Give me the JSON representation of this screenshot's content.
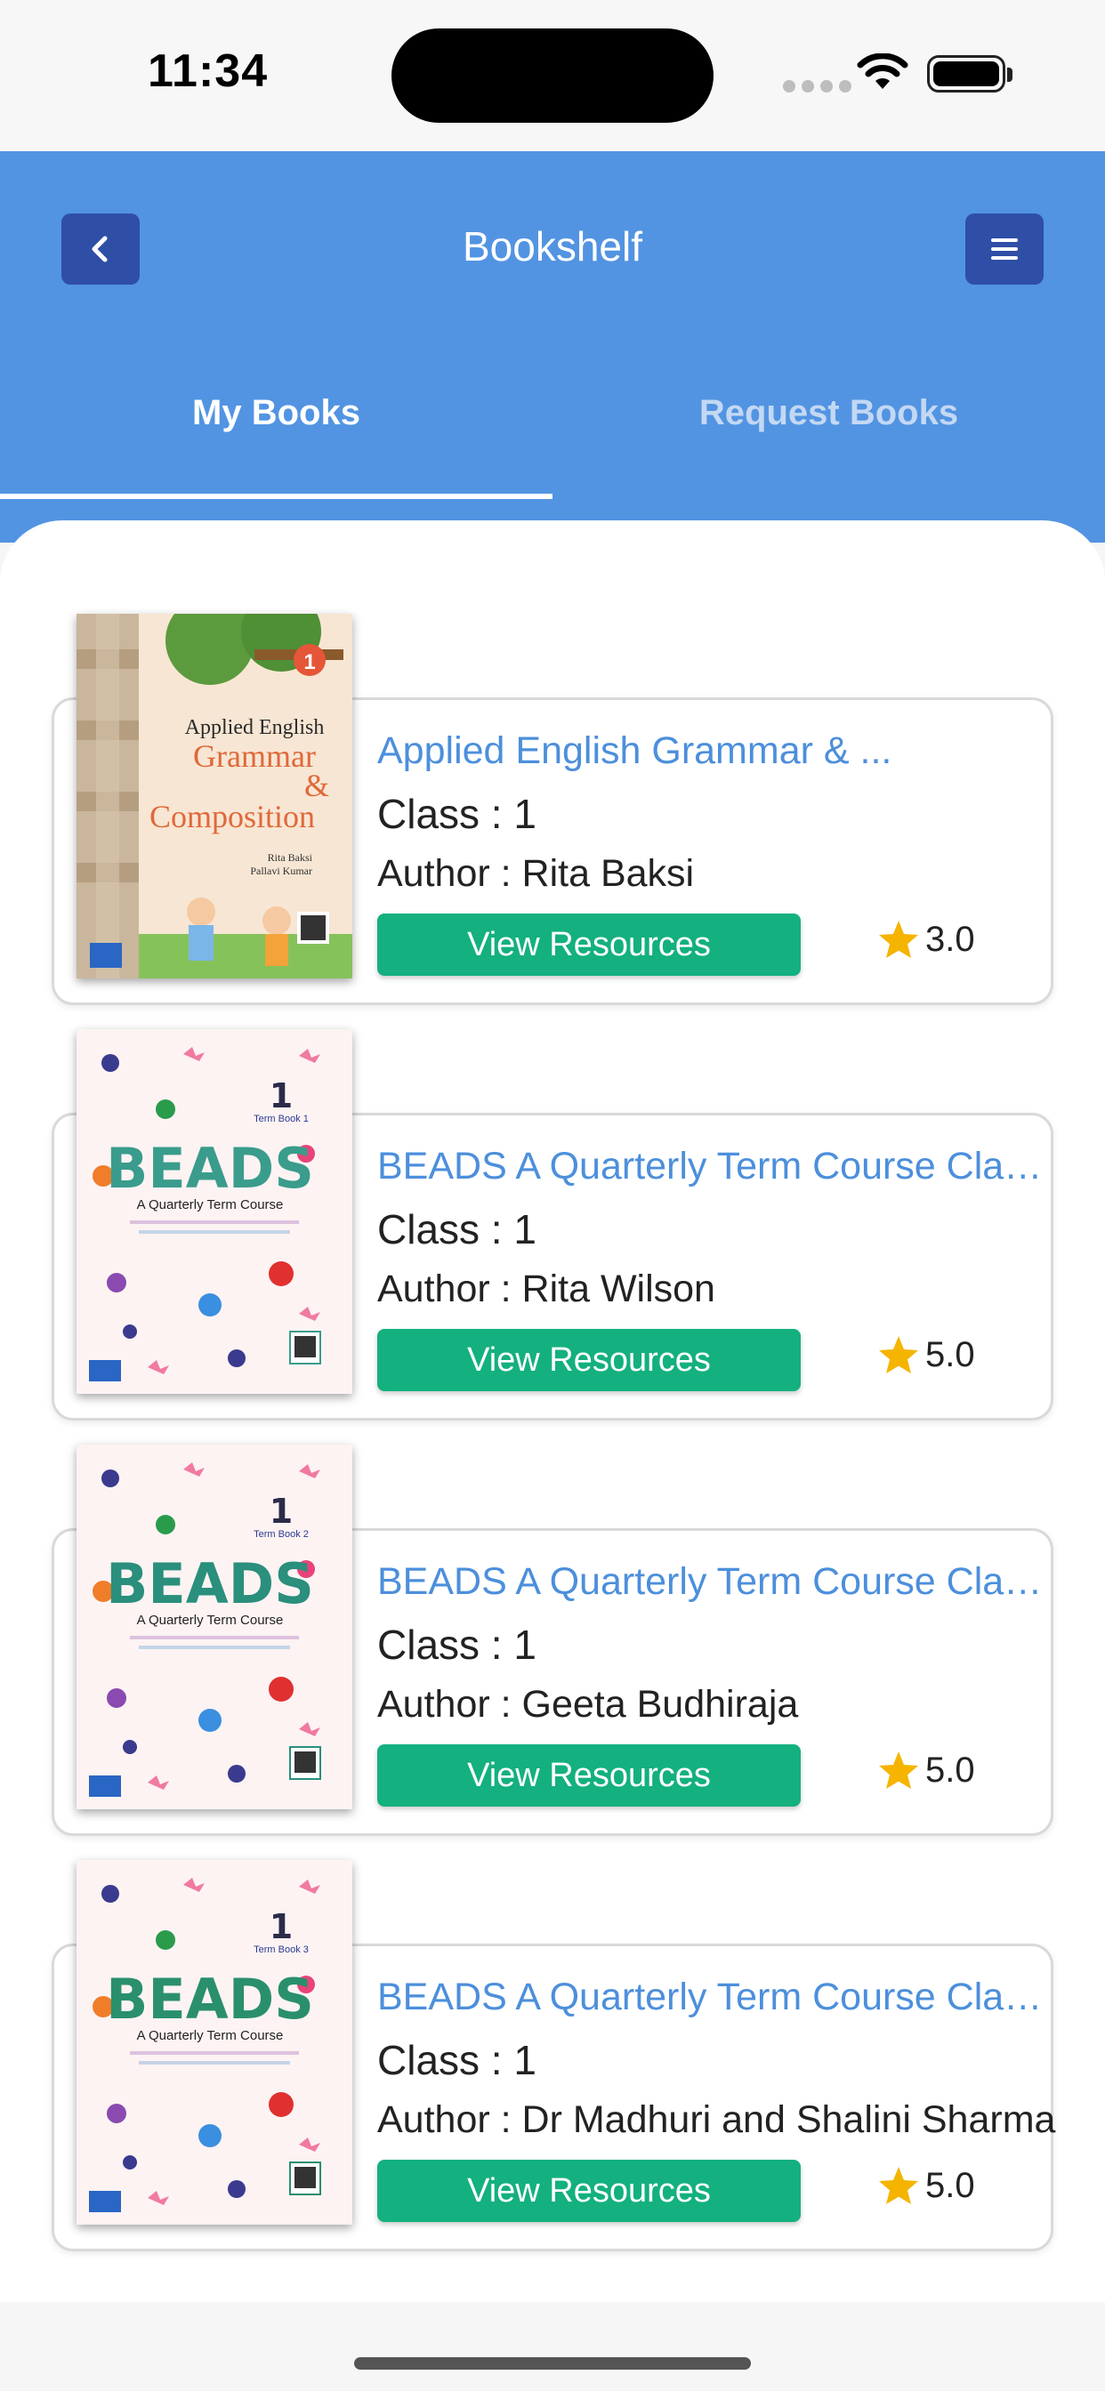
{
  "status_bar": {
    "time": "11:34"
  },
  "header": {
    "title": "Bookshelf",
    "tabs": [
      {
        "label": "My Books",
        "active": true
      },
      {
        "label": "Request Books",
        "active": false
      }
    ]
  },
  "books": [
    {
      "title": "Applied English Grammar & ...",
      "class": "Class : 1",
      "author": "Author : Rita Baksi",
      "button": "View Resources",
      "rating": "3.0",
      "cover": {
        "name": "Applied English Grammar & Composition",
        "number": "1",
        "authors": [
          "Rita Baksi",
          "Pallavi Kumar"
        ]
      }
    },
    {
      "title": "BEADS A Quarterly Term Course Class ...",
      "class": "Class : 1",
      "author": "Author : Rita Wilson",
      "button": "View Resources",
      "rating": "5.0",
      "cover": {
        "name": "BEADS",
        "subtitle": "A Quarterly Term Course",
        "number": "1",
        "term": "Term Book 1"
      }
    },
    {
      "title": "BEADS A Quarterly Term Course Class ...",
      "class": "Class : 1",
      "author": "Author : Geeta Budhiraja",
      "button": "View Resources",
      "rating": "5.0",
      "cover": {
        "name": "BEADS",
        "subtitle": "A Quarterly Term Course",
        "number": "1",
        "term": "Term Book 2"
      }
    },
    {
      "title": "BEADS A Quarterly Term Course Class ...",
      "class": "Class : 1",
      "author": "Author : Dr Madhuri and Shalini Sharma",
      "button": "View Resources",
      "rating": "5.0",
      "cover": {
        "name": "BEADS",
        "subtitle": "A Quarterly Term Course",
        "number": "1",
        "term": "Term Book 3"
      }
    }
  ],
  "colors": {
    "header": "#5294e2",
    "nav_button": "#2f4ea6",
    "link": "#4c8fdc",
    "action": "#14b07f",
    "star": "#f5b400"
  }
}
